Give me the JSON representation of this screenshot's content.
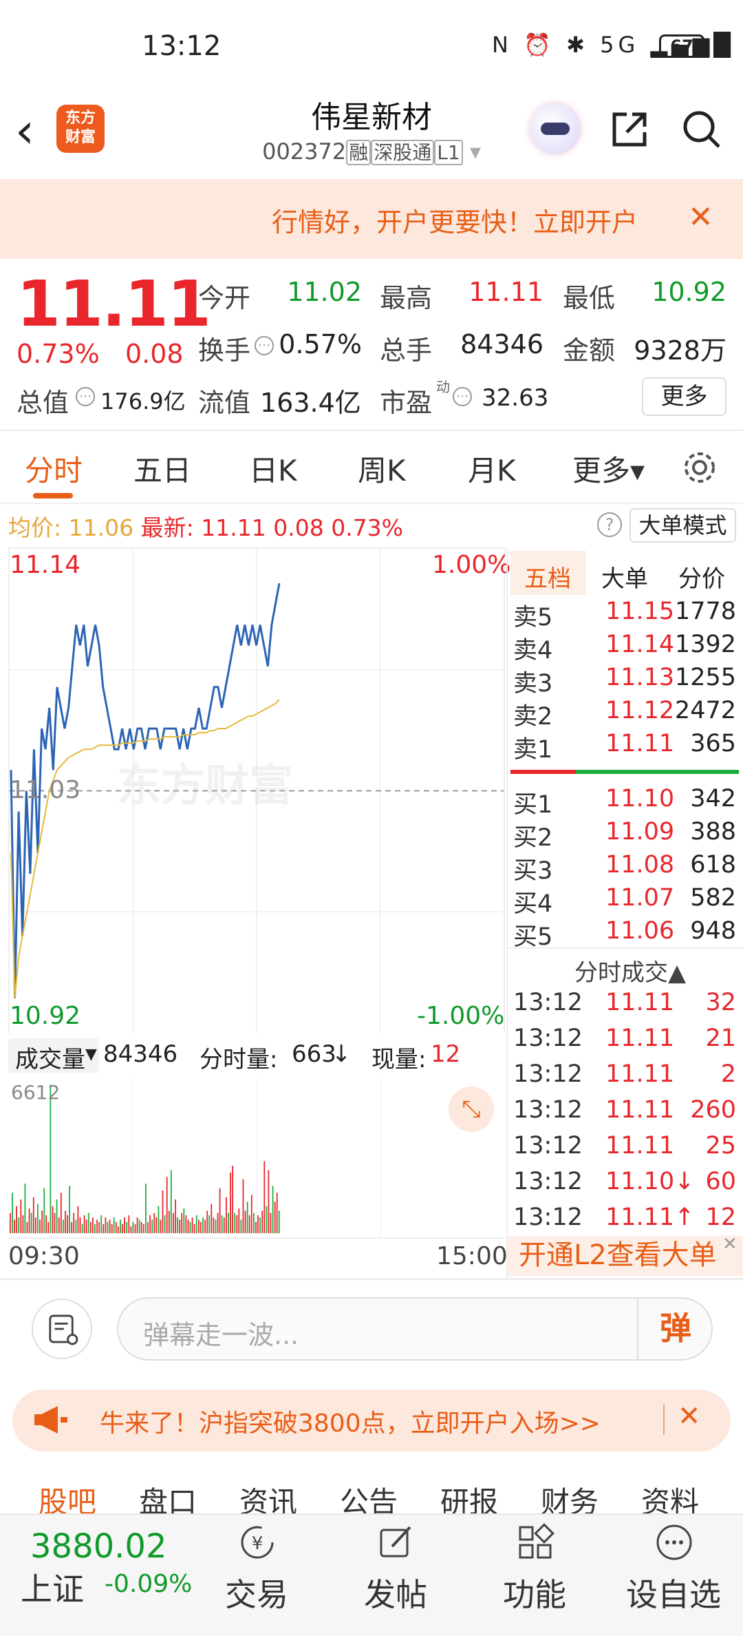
{
  "status": {
    "time": "13:12",
    "icons": "N ⏰ ✱ 5G ▂▄▆█",
    "battery": "67"
  },
  "header": {
    "logo": "东方财富",
    "name": "伟星新材",
    "code": "002372",
    "tags": [
      "融",
      "深股通",
      "L1"
    ]
  },
  "banner": {
    "text": "行情好，开户更要快！立即开户",
    "close": "✕"
  },
  "quote": {
    "price": "11.11",
    "pct": "0.73%",
    "change": "0.08",
    "fields": [
      {
        "label": "今开",
        "value": "11.02",
        "color": "green"
      },
      {
        "label": "最高",
        "value": "11.11",
        "color": "red"
      },
      {
        "label": "最低",
        "value": "10.92",
        "color": "green"
      },
      {
        "label": "换手",
        "value": "0.57%",
        "color": "black"
      },
      {
        "label": "总手",
        "value": "84346",
        "color": "black"
      },
      {
        "label": "金额",
        "value": "9328万",
        "color": "black"
      },
      {
        "label": "总值",
        "value": "176.9亿",
        "color": "black"
      },
      {
        "label": "流值",
        "value": "163.4亿",
        "color": "black"
      },
      {
        "label": "市盈",
        "value": "32.63",
        "color": "black",
        "superscript": "动"
      }
    ],
    "more": "更多"
  },
  "tabs": [
    "分时",
    "五日",
    "日K",
    "周K",
    "月K",
    "更多▾"
  ],
  "infoline": {
    "avg_label": "均价:",
    "avg": "11.06",
    "latest_label": "最新:",
    "latest": "11.11",
    "change": "0.08",
    "pct": "0.73%",
    "big_order_btn": "大单模式"
  },
  "chart": {
    "high_price": "11.14",
    "high_pct": "1.00%",
    "mid_price": "11.03",
    "low_price": "10.92",
    "low_pct": "-1.00%",
    "watermark": "东方财富",
    "price_color": "#2b64b5",
    "avg_color": "#e6b93a"
  },
  "chart_data": {
    "type": "line",
    "title": "",
    "ylim": [
      10.92,
      11.14
    ],
    "series": [
      {
        "name": "",
        "values": [
          11.04,
          10.93,
          11.02,
          10.96,
          11.03,
          10.99,
          11.05,
          11.0,
          11.06,
          11.05,
          11.07,
          11.04,
          11.08,
          11.07,
          11.06,
          11.07,
          11.09,
          11.11,
          11.1,
          11.11,
          11.09,
          11.1,
          11.11,
          11.1,
          11.08,
          11.07,
          11.06,
          11.05,
          11.05,
          11.06,
          11.05,
          11.06,
          11.05,
          11.06,
          11.06,
          11.05,
          11.06,
          11.06,
          11.06,
          11.05,
          11.06,
          11.06,
          11.06,
          11.06,
          11.05,
          11.06,
          11.05,
          11.06,
          11.06,
          11.07,
          11.06,
          11.06,
          11.07,
          11.08,
          11.08,
          11.07,
          11.08,
          11.09,
          11.1,
          11.11,
          11.1,
          11.11,
          11.1,
          11.11,
          11.1,
          11.11,
          11.1,
          11.09,
          11.11,
          11.12,
          11.13
        ]
      },
      {
        "name": "",
        "values": [
          11.0,
          10.93,
          10.95,
          10.96,
          10.97,
          10.98,
          10.99,
          11.0,
          11.01,
          11.02,
          11.03,
          11.035,
          11.04,
          11.042,
          11.044,
          11.046,
          11.047,
          11.048,
          11.049,
          11.05,
          11.05,
          11.05,
          11.051,
          11.052,
          11.052,
          11.052,
          11.052,
          11.052,
          11.052,
          11.053,
          11.053,
          11.053,
          11.053,
          11.054,
          11.054,
          11.054,
          11.055,
          11.055,
          11.055,
          11.055,
          11.056,
          11.056,
          11.056,
          11.056,
          11.056,
          11.057,
          11.057,
          11.057,
          11.057,
          11.058,
          11.058,
          11.058,
          11.059,
          11.059,
          11.06,
          11.06,
          11.06,
          11.061,
          11.062,
          11.063,
          11.064,
          11.065,
          11.066,
          11.066,
          11.067,
          11.068,
          11.069,
          11.07,
          11.071,
          11.072,
          11.074
        ]
      }
    ],
    "volume": {
      "max": 6612,
      "values": [
        900,
        1800,
        600,
        1200,
        700,
        1500,
        800,
        2200,
        500,
        1100,
        900,
        1600,
        700,
        1300,
        600,
        1000,
        2000,
        800,
        500,
        6600,
        1200,
        900,
        1500,
        700,
        1800,
        600,
        1000,
        800,
        2100,
        500,
        900,
        600,
        1200,
        700,
        400,
        800,
        600,
        900,
        500,
        700,
        400,
        600,
        500,
        800,
        400,
        700,
        500,
        600,
        400,
        700,
        500,
        300,
        600,
        400,
        700,
        500,
        800,
        300,
        500,
        400,
        700,
        600,
        500,
        400,
        2200,
        500,
        800,
        600,
        900,
        700,
        1200,
        600,
        1900,
        800,
        2500,
        1000,
        2800,
        900,
        1500,
        700,
        600,
        900,
        1100,
        800,
        600,
        500,
        700,
        400,
        800,
        600,
        500,
        700,
        600,
        1000,
        800,
        1300,
        700,
        600,
        900,
        2000,
        800,
        700,
        1600,
        900,
        2700,
        3000,
        900,
        800,
        1100,
        600,
        2400,
        1000,
        1400,
        800,
        1700,
        900,
        500,
        800,
        700,
        1000,
        3200,
        1200,
        2800,
        900,
        2100,
        1400,
        1800,
        1000
      ]
    }
  },
  "orderbook": {
    "tabs": [
      "五档",
      "大单",
      "分价"
    ],
    "sell": [
      {
        "label": "卖5",
        "price": "11.15",
        "vol": "1778"
      },
      {
        "label": "卖4",
        "price": "11.14",
        "vol": "1392"
      },
      {
        "label": "卖3",
        "price": "11.13",
        "vol": "1255"
      },
      {
        "label": "卖2",
        "price": "11.12",
        "vol": "2472"
      },
      {
        "label": "卖1",
        "price": "11.11",
        "vol": "365"
      }
    ],
    "buy": [
      {
        "label": "买1",
        "price": "11.10",
        "vol": "342"
      },
      {
        "label": "买2",
        "price": "11.09",
        "vol": "388"
      },
      {
        "label": "买3",
        "price": "11.08",
        "vol": "618"
      },
      {
        "label": "买4",
        "price": "11.07",
        "vol": "582"
      },
      {
        "label": "买5",
        "price": "11.06",
        "vol": "948"
      }
    ],
    "ticks_title": "分时成交▲",
    "ticks": [
      {
        "time": "13:12",
        "price": "11.11",
        "vol": "32",
        "dir": ""
      },
      {
        "time": "13:12",
        "price": "11.11",
        "vol": "21",
        "dir": ""
      },
      {
        "time": "13:12",
        "price": "11.11",
        "vol": "2",
        "dir": ""
      },
      {
        "time": "13:12",
        "price": "11.11",
        "vol": "260",
        "dir": ""
      },
      {
        "time": "13:12",
        "price": "11.11",
        "vol": "25",
        "dir": ""
      },
      {
        "time": "13:12",
        "price": "11.10",
        "vol": "60",
        "dir": "↓"
      },
      {
        "time": "13:12",
        "price": "11.11",
        "vol": "12",
        "dir": "↑"
      }
    ],
    "l2": "开通L2查看大单"
  },
  "volume": {
    "label": "成交量",
    "total": "84346",
    "fenshi_label": "分时量:",
    "fenshi": "663",
    "fenshi_arrow": "↓",
    "xianliang_label": "现量:",
    "xianliang": "12",
    "max_label": "6612",
    "start": "09:30",
    "end": "15:00",
    "expand": "⤡"
  },
  "danmu": {
    "placeholder": "弹幕走一波...",
    "button": "弹"
  },
  "promo": {
    "text": "牛来了！沪指突破3800点，立即开户入场>>",
    "close": "✕"
  },
  "subtabs": [
    "股吧",
    "盘口",
    "资讯",
    "公告",
    "研报",
    "财务",
    "资料"
  ],
  "bottom": {
    "index_value": "3880.02",
    "index_name": "上证",
    "index_change": "-0.09%",
    "items": [
      "交易",
      "发帖",
      "功能",
      "设自选"
    ]
  }
}
